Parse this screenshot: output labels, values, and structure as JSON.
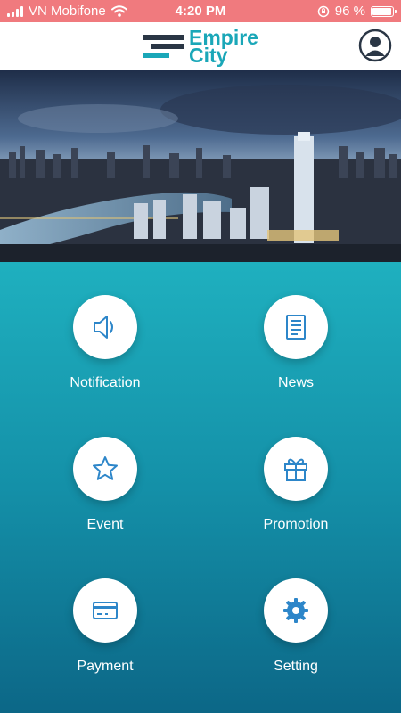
{
  "status_bar": {
    "carrier": "VN Mobifone",
    "time": "4:20 PM",
    "battery": "96 %",
    "battery_level": 0.96
  },
  "header": {
    "logo_line1": "Empire",
    "logo_line2": "City"
  },
  "colors": {
    "status_bar": "#f07a7e",
    "accent": "#1aa7b8",
    "logo_dark": "#2a3645",
    "icon_blue": "#2d86c9"
  },
  "menu": {
    "items": [
      {
        "label": "Notification",
        "icon": "speaker-icon"
      },
      {
        "label": "News",
        "icon": "document-icon"
      },
      {
        "label": "Event",
        "icon": "star-icon"
      },
      {
        "label": "Promotion",
        "icon": "gift-icon"
      },
      {
        "label": "Payment",
        "icon": "credit-card-icon"
      },
      {
        "label": "Setting",
        "icon": "gear-icon"
      }
    ]
  }
}
